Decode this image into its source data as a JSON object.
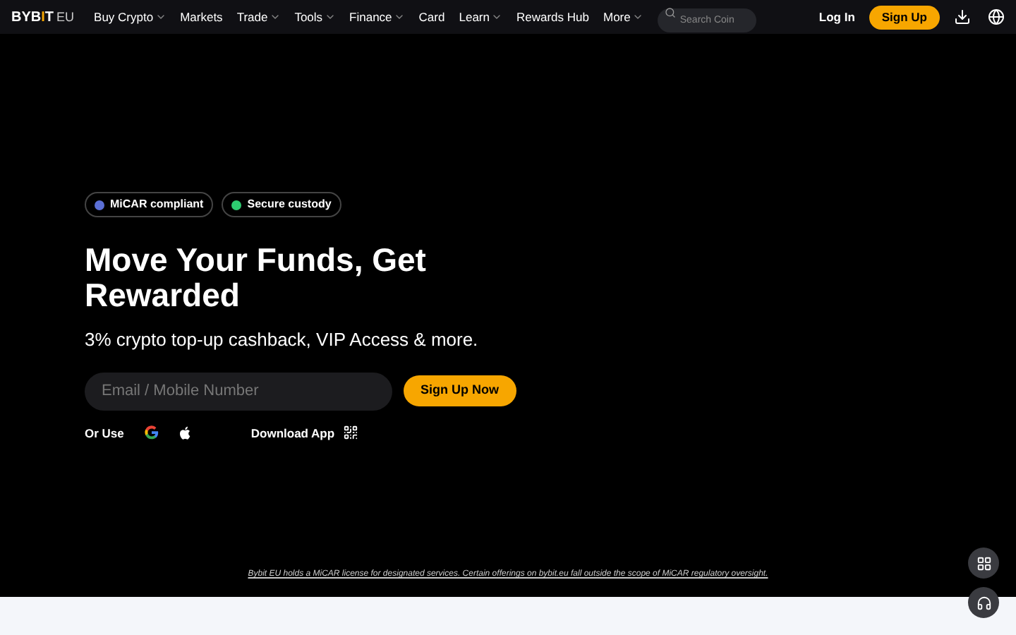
{
  "logo": {
    "main": "BYB",
    "accent": "I",
    "end": "T",
    "suffix": "EU"
  },
  "nav": [
    {
      "label": "Buy Crypto",
      "has_menu": true
    },
    {
      "label": "Markets",
      "has_menu": false
    },
    {
      "label": "Trade",
      "has_menu": true
    },
    {
      "label": "Tools",
      "has_menu": true
    },
    {
      "label": "Finance",
      "has_menu": true
    },
    {
      "label": "Card",
      "has_menu": false
    },
    {
      "label": "Learn",
      "has_menu": true
    },
    {
      "label": "Rewards Hub",
      "has_menu": false
    },
    {
      "label": "More",
      "has_menu": true
    }
  ],
  "search": {
    "placeholder": "Search Coin"
  },
  "login": "Log In",
  "signup": "Sign Up",
  "badges": [
    {
      "label": "MiCAR compliant",
      "color": "#5b6fd6"
    },
    {
      "label": "Secure custody",
      "color": "#2ecc71"
    }
  ],
  "hero": {
    "title": "Move Your Funds, Get Rewarded",
    "subtitle": "3% crypto top-up cashback, VIP Access & more.",
    "email_placeholder": "Email / Mobile Number",
    "cta": "Sign Up Now",
    "or_use": "Or Use",
    "download": "Download App"
  },
  "disclaimer": "Bybit EU holds a MiCAR license for designated services. Certain offerings on bybit.eu fall outside the scope of MiCAR regulatory oversight."
}
